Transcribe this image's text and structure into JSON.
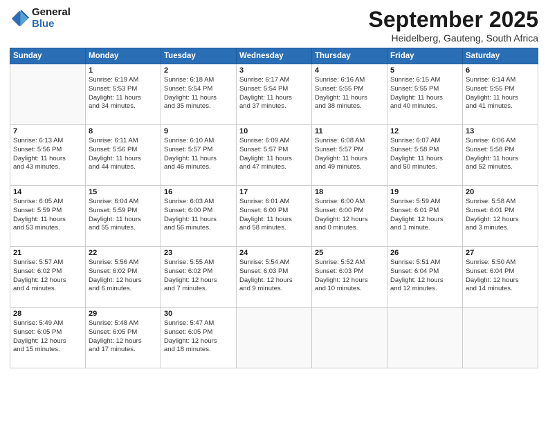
{
  "header": {
    "logo_line1": "General",
    "logo_line2": "Blue",
    "month": "September 2025",
    "location": "Heidelberg, Gauteng, South Africa"
  },
  "days_of_week": [
    "Sunday",
    "Monday",
    "Tuesday",
    "Wednesday",
    "Thursday",
    "Friday",
    "Saturday"
  ],
  "weeks": [
    [
      {
        "day": "",
        "info": ""
      },
      {
        "day": "1",
        "info": "Sunrise: 6:19 AM\nSunset: 5:53 PM\nDaylight: 11 hours\nand 34 minutes."
      },
      {
        "day": "2",
        "info": "Sunrise: 6:18 AM\nSunset: 5:54 PM\nDaylight: 11 hours\nand 35 minutes."
      },
      {
        "day": "3",
        "info": "Sunrise: 6:17 AM\nSunset: 5:54 PM\nDaylight: 11 hours\nand 37 minutes."
      },
      {
        "day": "4",
        "info": "Sunrise: 6:16 AM\nSunset: 5:55 PM\nDaylight: 11 hours\nand 38 minutes."
      },
      {
        "day": "5",
        "info": "Sunrise: 6:15 AM\nSunset: 5:55 PM\nDaylight: 11 hours\nand 40 minutes."
      },
      {
        "day": "6",
        "info": "Sunrise: 6:14 AM\nSunset: 5:55 PM\nDaylight: 11 hours\nand 41 minutes."
      }
    ],
    [
      {
        "day": "7",
        "info": "Sunrise: 6:13 AM\nSunset: 5:56 PM\nDaylight: 11 hours\nand 43 minutes."
      },
      {
        "day": "8",
        "info": "Sunrise: 6:11 AM\nSunset: 5:56 PM\nDaylight: 11 hours\nand 44 minutes."
      },
      {
        "day": "9",
        "info": "Sunrise: 6:10 AM\nSunset: 5:57 PM\nDaylight: 11 hours\nand 46 minutes."
      },
      {
        "day": "10",
        "info": "Sunrise: 6:09 AM\nSunset: 5:57 PM\nDaylight: 11 hours\nand 47 minutes."
      },
      {
        "day": "11",
        "info": "Sunrise: 6:08 AM\nSunset: 5:57 PM\nDaylight: 11 hours\nand 49 minutes."
      },
      {
        "day": "12",
        "info": "Sunrise: 6:07 AM\nSunset: 5:58 PM\nDaylight: 11 hours\nand 50 minutes."
      },
      {
        "day": "13",
        "info": "Sunrise: 6:06 AM\nSunset: 5:58 PM\nDaylight: 11 hours\nand 52 minutes."
      }
    ],
    [
      {
        "day": "14",
        "info": "Sunrise: 6:05 AM\nSunset: 5:59 PM\nDaylight: 11 hours\nand 53 minutes."
      },
      {
        "day": "15",
        "info": "Sunrise: 6:04 AM\nSunset: 5:59 PM\nDaylight: 11 hours\nand 55 minutes."
      },
      {
        "day": "16",
        "info": "Sunrise: 6:03 AM\nSunset: 6:00 PM\nDaylight: 11 hours\nand 56 minutes."
      },
      {
        "day": "17",
        "info": "Sunrise: 6:01 AM\nSunset: 6:00 PM\nDaylight: 11 hours\nand 58 minutes."
      },
      {
        "day": "18",
        "info": "Sunrise: 6:00 AM\nSunset: 6:00 PM\nDaylight: 12 hours\nand 0 minutes."
      },
      {
        "day": "19",
        "info": "Sunrise: 5:59 AM\nSunset: 6:01 PM\nDaylight: 12 hours\nand 1 minute."
      },
      {
        "day": "20",
        "info": "Sunrise: 5:58 AM\nSunset: 6:01 PM\nDaylight: 12 hours\nand 3 minutes."
      }
    ],
    [
      {
        "day": "21",
        "info": "Sunrise: 5:57 AM\nSunset: 6:02 PM\nDaylight: 12 hours\nand 4 minutes."
      },
      {
        "day": "22",
        "info": "Sunrise: 5:56 AM\nSunset: 6:02 PM\nDaylight: 12 hours\nand 6 minutes."
      },
      {
        "day": "23",
        "info": "Sunrise: 5:55 AM\nSunset: 6:02 PM\nDaylight: 12 hours\nand 7 minutes."
      },
      {
        "day": "24",
        "info": "Sunrise: 5:54 AM\nSunset: 6:03 PM\nDaylight: 12 hours\nand 9 minutes."
      },
      {
        "day": "25",
        "info": "Sunrise: 5:52 AM\nSunset: 6:03 PM\nDaylight: 12 hours\nand 10 minutes."
      },
      {
        "day": "26",
        "info": "Sunrise: 5:51 AM\nSunset: 6:04 PM\nDaylight: 12 hours\nand 12 minutes."
      },
      {
        "day": "27",
        "info": "Sunrise: 5:50 AM\nSunset: 6:04 PM\nDaylight: 12 hours\nand 14 minutes."
      }
    ],
    [
      {
        "day": "28",
        "info": "Sunrise: 5:49 AM\nSunset: 6:05 PM\nDaylight: 12 hours\nand 15 minutes."
      },
      {
        "day": "29",
        "info": "Sunrise: 5:48 AM\nSunset: 6:05 PM\nDaylight: 12 hours\nand 17 minutes."
      },
      {
        "day": "30",
        "info": "Sunrise: 5:47 AM\nSunset: 6:05 PM\nDaylight: 12 hours\nand 18 minutes."
      },
      {
        "day": "",
        "info": ""
      },
      {
        "day": "",
        "info": ""
      },
      {
        "day": "",
        "info": ""
      },
      {
        "day": "",
        "info": ""
      }
    ]
  ]
}
